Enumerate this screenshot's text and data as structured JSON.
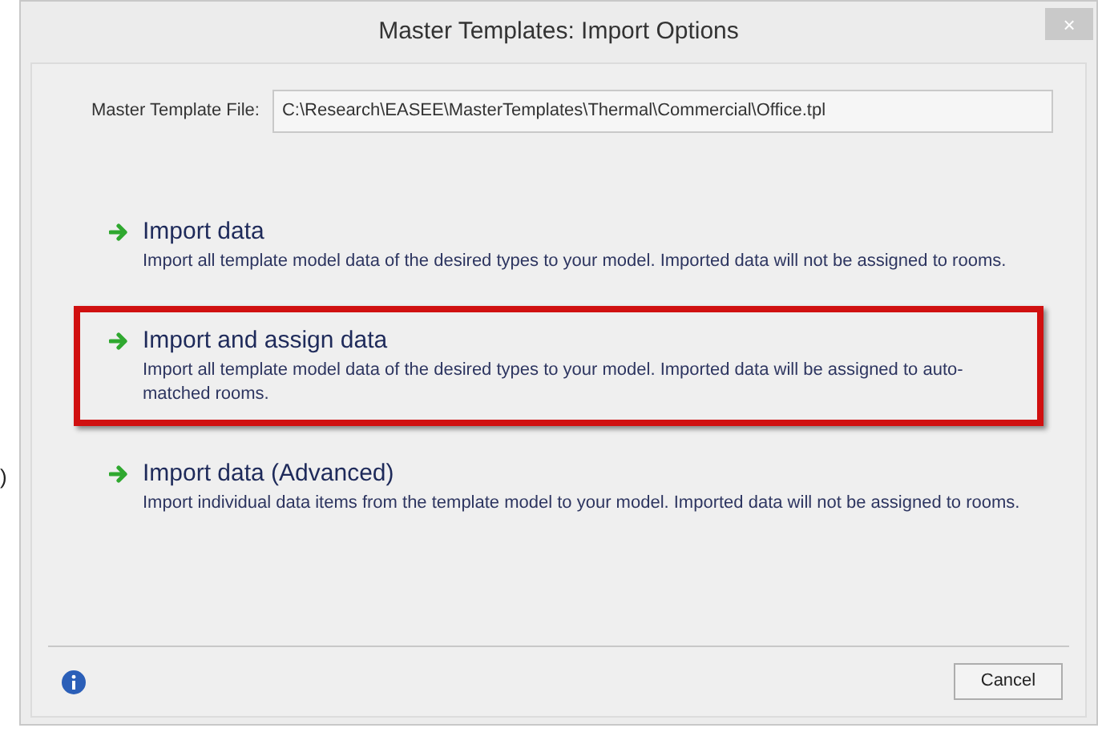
{
  "window": {
    "title": "Master Templates: Import Options",
    "close": "×"
  },
  "file_field": {
    "label": "Master Template File:",
    "value": "C:\\Research\\EASEE\\MasterTemplates\\Thermal\\Commercial\\Office.tpl"
  },
  "options": [
    {
      "title": "Import data",
      "description": "Import all template model data of the desired types to your model. Imported data will not be assigned to rooms.",
      "highlighted": false
    },
    {
      "title": "Import and assign data",
      "description": "Import all template model data of the desired types to your model. Imported data will be assigned to auto-matched rooms.",
      "highlighted": true
    },
    {
      "title": "Import data (Advanced)",
      "description": "Import individual data items from the template model to your model. Imported data will not be assigned to rooms.",
      "highlighted": false
    }
  ],
  "stray_text": ")",
  "buttons": [
    "Cancel"
  ]
}
